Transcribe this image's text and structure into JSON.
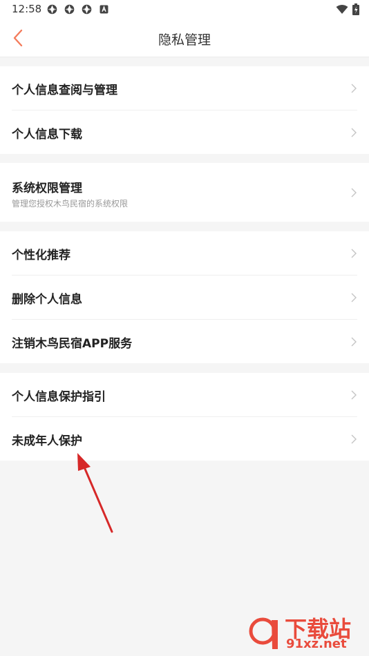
{
  "status_bar": {
    "time": "12:58",
    "left_icons": [
      "app-icon",
      "app-icon",
      "app-icon",
      "a-badge-icon"
    ],
    "right_icons": [
      "wifi-icon",
      "battery-icon"
    ]
  },
  "nav": {
    "title": "隐私管理",
    "back_icon": "chevron-left-icon",
    "accent_color": "#f47c5c"
  },
  "groups": [
    {
      "items": [
        {
          "label": "个人信息查阅与管理"
        },
        {
          "label": "个人信息下载"
        }
      ]
    },
    {
      "items": [
        {
          "label": "系统权限管理",
          "subtitle": "管理您授权木鸟民宿的系统权限"
        }
      ]
    },
    {
      "items": [
        {
          "label": "个性化推荐"
        },
        {
          "label": "删除个人信息"
        },
        {
          "label": "注销木鸟民宿APP服务"
        }
      ]
    },
    {
      "items": [
        {
          "label": "个人信息保护指引"
        },
        {
          "label": "未成年人保护"
        }
      ]
    }
  ],
  "watermark": {
    "text": "下载站",
    "domain": "91xz.net"
  },
  "colors": {
    "background": "#f5f5f5",
    "card": "#ffffff",
    "arrow": "#d62828",
    "watermark": "#e94b3c"
  }
}
